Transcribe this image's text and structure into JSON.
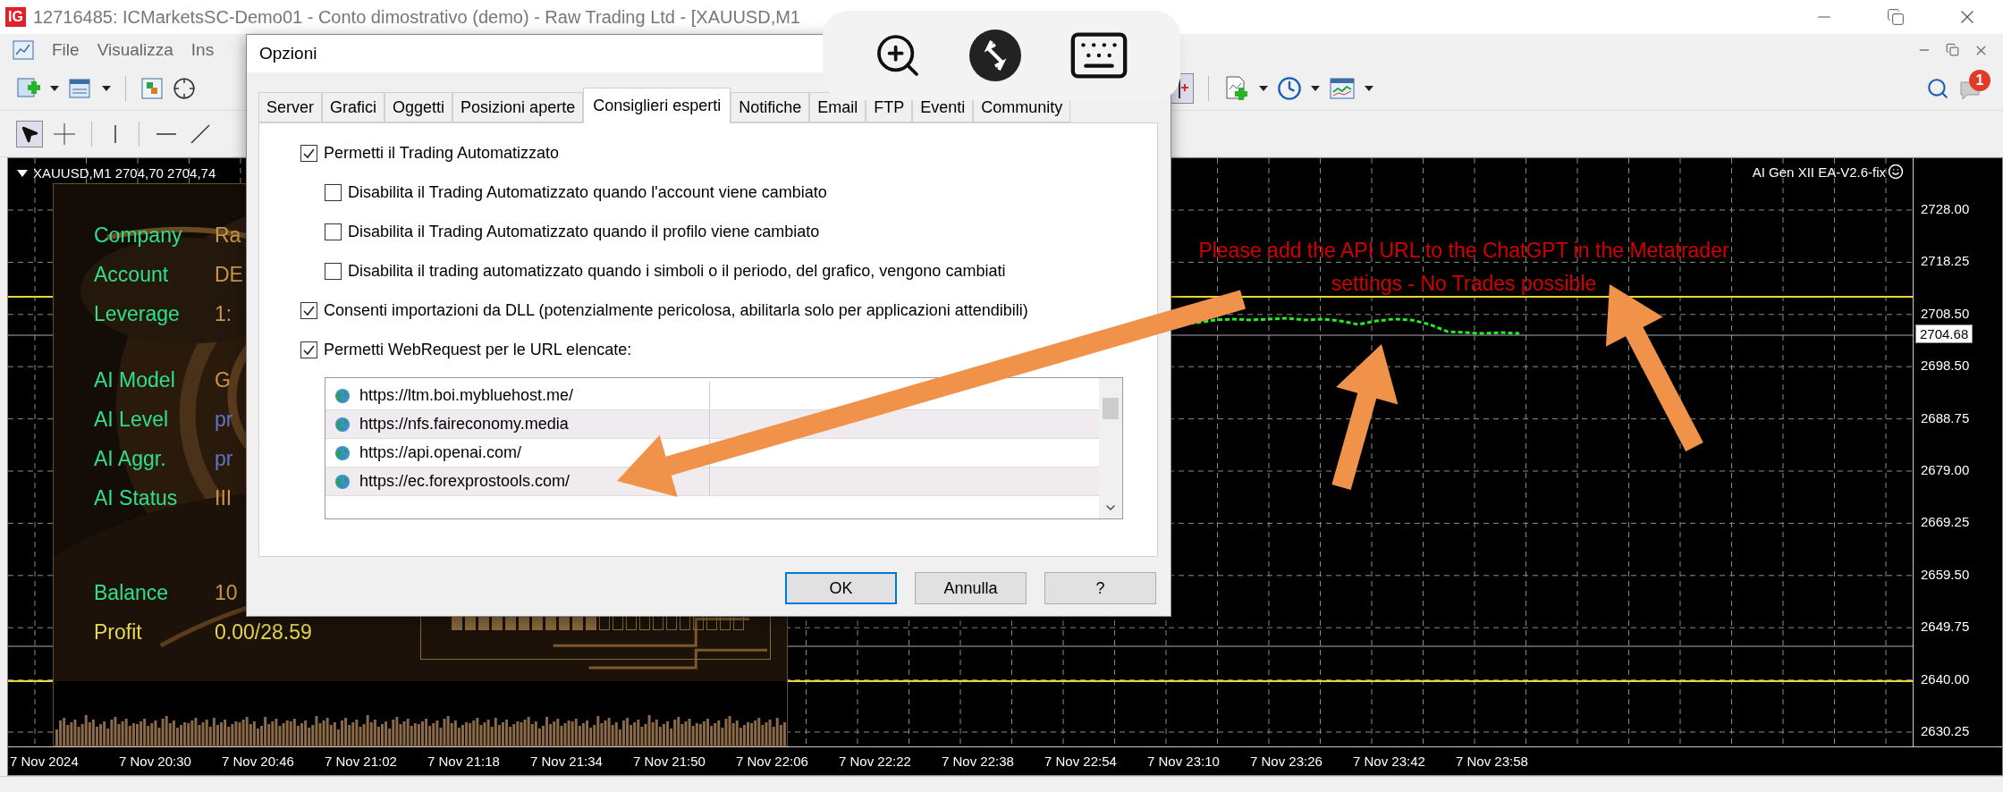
{
  "window": {
    "logo": "IG",
    "title": "12716485: ICMarketsSC-Demo01 - Conto dimostrativo (demo) - Raw Trading Ltd - [XAUUSD,M1"
  },
  "menu": [
    "File",
    "Visualizza",
    "Ins"
  ],
  "notifications": {
    "badge": "1"
  },
  "chart": {
    "header": "XAUUSD,M1  2704,70 2704,74",
    "expert": "AI Gen XII EA-V2.6-fix",
    "message": [
      "Please add the API URL to the ChatGPT in the Metatrader",
      "settings - No Trades possible"
    ],
    "price_axis": [
      "2728.00",
      "2718.25",
      "2708.50",
      "2698.50",
      "2688.75",
      "2679.00",
      "2669.25",
      "2659.50",
      "2649.75",
      "2640.00",
      "2630.25"
    ],
    "current_price": "2704.68",
    "time_axis": [
      "7 Nov 2024",
      "7 Nov 20:30",
      "7 Nov 20:46",
      "7 Nov 21:02",
      "7 Nov 21:18",
      "7 Nov 21:34",
      "7 Nov 21:50",
      "7 Nov 22:06",
      "7 Nov 22:22",
      "7 Nov 22:38",
      "7 Nov 22:54",
      "7 Nov 23:10",
      "7 Nov 23:26",
      "7 Nov 23:42",
      "7 Nov 23:58"
    ]
  },
  "ea_panel": {
    "groups": [
      {
        "rows": [
          {
            "label": "Company",
            "value": "Ra",
            "kind": "info",
            "color": "#c8964a"
          },
          {
            "label": "Account",
            "value": "DE",
            "kind": "info",
            "color": "#c8964a"
          },
          {
            "label": "Leverage",
            "value": "1:",
            "kind": "info",
            "color": "#c8964a"
          }
        ]
      },
      {
        "rows": [
          {
            "label": "AI Model",
            "value": "G",
            "kind": "info",
            "color": "#c8964a"
          },
          {
            "label": "AI Level",
            "value": "pr",
            "kind": "info",
            "color": "#5a78c8"
          },
          {
            "label": "AI Aggr.",
            "value": "pr",
            "kind": "info",
            "color": "#5a78c8"
          },
          {
            "label": "AI Status",
            "value": "III",
            "kind": "info",
            "color": "#c8964a"
          }
        ]
      },
      {
        "rows": [
          {
            "label": "Balance",
            "value": "10",
            "kind": "info",
            "color": "#c8964a"
          },
          {
            "label": "Profit",
            "value": "0.00/28.59",
            "kind": "profit",
            "color": "#e6d84a"
          }
        ]
      }
    ],
    "meter": {
      "level": 0.5
    }
  },
  "dialog": {
    "title": "Opzioni",
    "tabs": [
      {
        "label": "Server",
        "selected": false
      },
      {
        "label": "Grafici",
        "selected": false
      },
      {
        "label": "Oggetti",
        "selected": false
      },
      {
        "label": "Posizioni aperte",
        "selected": false
      },
      {
        "label": "Consiglieri esperti",
        "selected": true
      },
      {
        "label": "Notifiche",
        "selected": false
      },
      {
        "label": "Email",
        "selected": false
      },
      {
        "label": "FTP",
        "selected": false
      },
      {
        "label": "Eventi",
        "selected": false
      },
      {
        "label": "Community",
        "selected": false
      }
    ],
    "options": [
      {
        "label": "Permetti il Trading Automatizzato",
        "checked": true,
        "children": [
          {
            "label": "Disabilita il Trading Automatizzato quando l'account viene cambiato",
            "checked": false
          },
          {
            "label": "Disabilita il Trading Automatizzato quando il profilo viene cambiato",
            "checked": false
          },
          {
            "label": "Disabilita il trading automatizzato quando i simboli o il periodo, del grafico, vengono cambiati",
            "checked": false
          }
        ]
      },
      {
        "label": "Consenti importazioni da DLL (potenzialmente pericolosa, abilitarla solo per applicazioni attendibili)",
        "checked": true
      },
      {
        "label": "Permetti WebRequest per le URL elencate:",
        "checked": true
      }
    ],
    "urls": [
      "https://ltm.boi.mybluehost.me/",
      "https://nfs.faireconomy.media",
      "https://api.openai.com/",
      "https://ec.forexprostools.com/"
    ],
    "buttons": [
      {
        "label": "OK",
        "selected": true
      },
      {
        "label": "Annulla",
        "selected": false
      },
      {
        "label": "?",
        "selected": false
      }
    ]
  }
}
